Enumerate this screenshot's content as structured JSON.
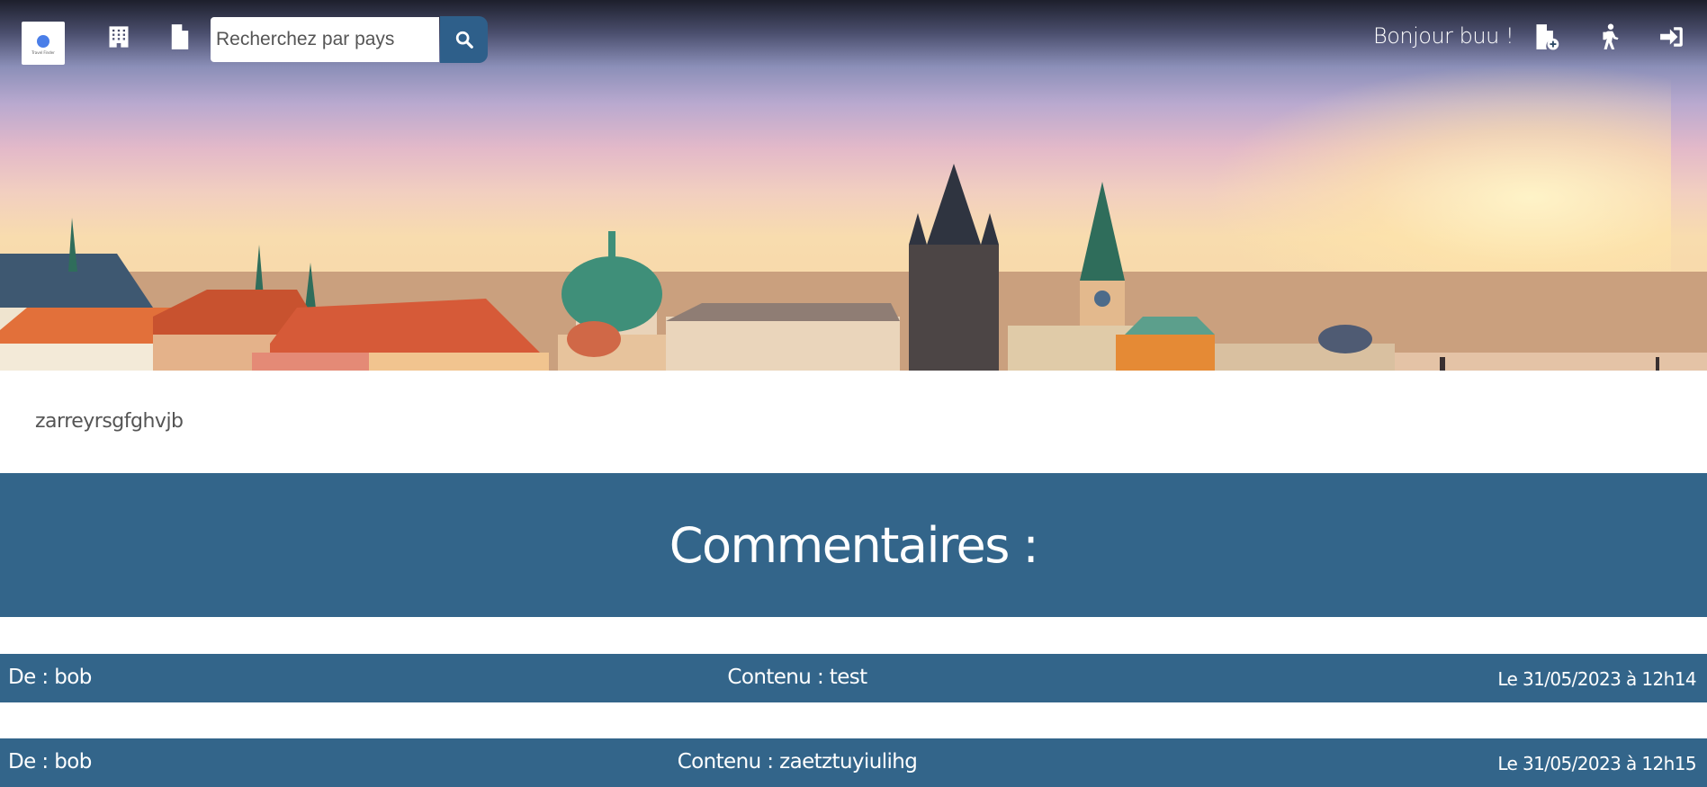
{
  "header": {
    "logo_text": "Travel Finder",
    "search_placeholder": "Recherchez par pays",
    "greeting": "Bonjour buu !",
    "icons": [
      "building-icon",
      "file-icon",
      "search-icon",
      "file-add-icon",
      "hiking-icon",
      "sign-in-icon"
    ]
  },
  "description": "zarreyrsgfghvjb",
  "comments": {
    "title": "Commentaires :",
    "items": [
      {
        "author": "De : bob",
        "content": "Contenu : test",
        "date": "Le 31/05/2023 à 12h14"
      },
      {
        "author": "De : bob",
        "content": "Contenu : zaetztuyiulihg",
        "date": "Le 31/05/2023 à 12h15"
      }
    ]
  },
  "colors": {
    "primary": "#33658a",
    "search_button": "#2e5f8a",
    "white": "#ffffff"
  }
}
